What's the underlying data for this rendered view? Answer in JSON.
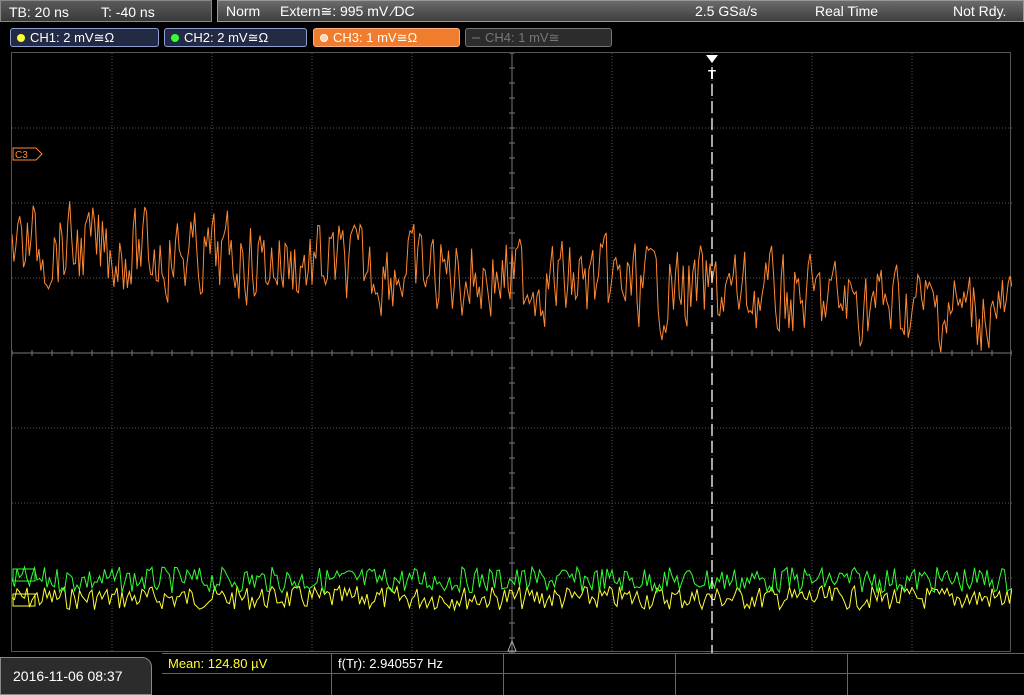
{
  "timebase": {
    "tb": "TB: 20 ns",
    "trig_time": "T: -40 ns"
  },
  "acquisition": {
    "mode": "Norm",
    "trigger": "Extern≅: 995 mV ∕DC",
    "sample_rate": "2.5 GSa/s",
    "acq_mode": "Real Time",
    "status": "Not Rdy."
  },
  "channels": [
    {
      "label": "CH1: 2 mV≅Ω",
      "color": "#ffff33",
      "state": "on"
    },
    {
      "label": "CH2: 2 mV≅Ω",
      "color": "#33ff33",
      "state": "on"
    },
    {
      "label": "CH3: 1 mV≅Ω",
      "color": "#ff8833",
      "state": "selected"
    },
    {
      "label": "CH4: 1 mV≅",
      "color": "#777777",
      "state": "off"
    }
  ],
  "markers": {
    "ch3": "C3",
    "trigger": "T"
  },
  "measurements": {
    "mean": "Mean: 124.80 µV",
    "freq": "f(Tr): 2.940557 Hz"
  },
  "datetime": "2016-11-06 08:37",
  "colors": {
    "grid": "#555555",
    "ch1": "#ffff33",
    "ch2": "#33ff33",
    "ch3": "#ff8833",
    "trigger": "#ffffff"
  }
}
